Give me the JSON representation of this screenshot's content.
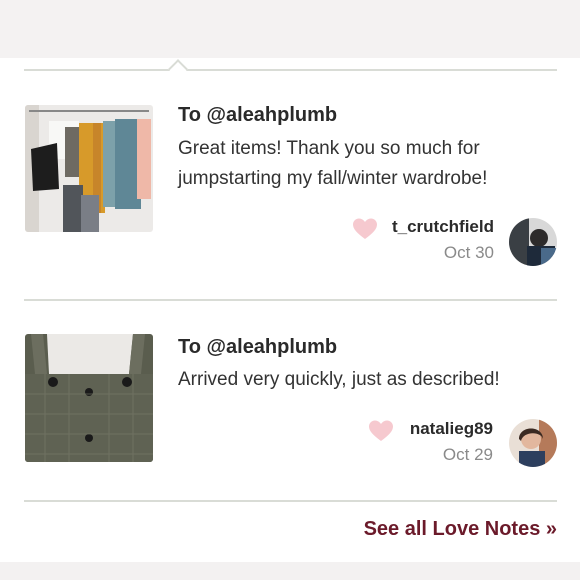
{
  "notes": [
    {
      "recipient": "To @aleahplumb",
      "message": "Great items! Thank you so much for jumpstarting my fall/winter wardrobe!",
      "username": "t_crutchfield",
      "date": "Oct 30",
      "thumbnail": "clothing-rack-photo",
      "avatar": "user-avatar-photo"
    },
    {
      "recipient": "To @aleahplumb",
      "message": "Arrived very quickly, just as described!",
      "username": "natalieg89",
      "date": "Oct 29",
      "thumbnail": "plaid-overall-dress-photo",
      "avatar": "user-avatar-photo"
    }
  ],
  "footer": {
    "see_all_label": "See all Love Notes »"
  },
  "colors": {
    "heart": "#f6c9cf",
    "link": "#6b1a2a",
    "divider": "#d9dcd6"
  }
}
